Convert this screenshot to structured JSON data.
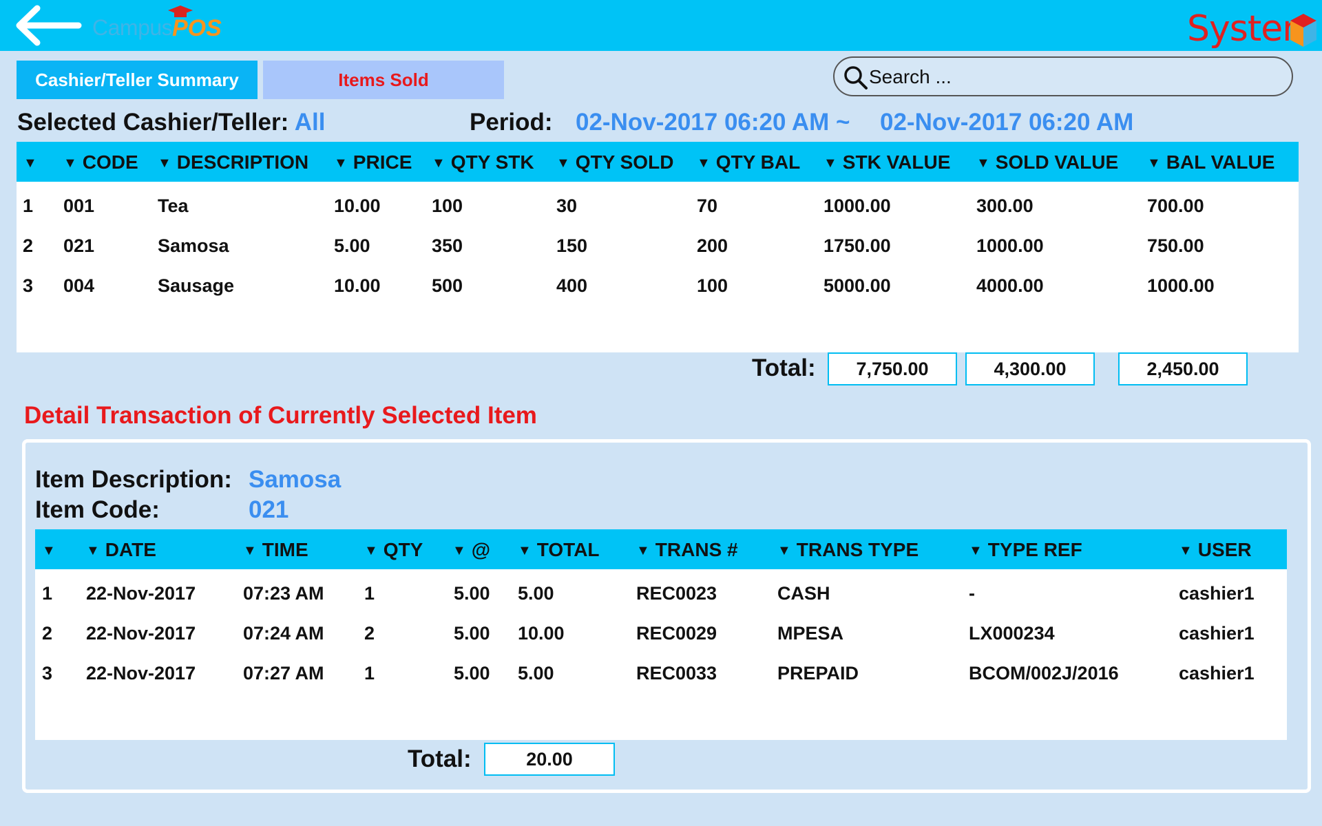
{
  "header": {
    "logo_campus": "Campus",
    "logo_pos": "POS",
    "logo_right": "System"
  },
  "tabs": [
    {
      "label": "Cashier/Teller Summary"
    },
    {
      "label": "Items Sold"
    }
  ],
  "search": {
    "placeholder": "Search ..."
  },
  "summary": {
    "cashier_label": "Selected Cashier/Teller:",
    "cashier_value": "All",
    "period_label": "Period:",
    "period_from": "02-Nov-2017 06:20 AM ~",
    "period_to": "02-Nov-2017 06:20 AM"
  },
  "items_table": {
    "columns": [
      "",
      "CODE",
      "DESCRIPTION",
      "PRICE",
      "QTY STK",
      "QTY SOLD",
      "QTY BAL",
      "STK VALUE",
      "SOLD VALUE",
      "BAL VALUE"
    ],
    "rows": [
      [
        "1",
        "001",
        "Tea",
        "10.00",
        "100",
        "30",
        "70",
        "1000.00",
        "300.00",
        "700.00"
      ],
      [
        "2",
        "021",
        "Samosa",
        "5.00",
        "350",
        "150",
        "200",
        "1750.00",
        "1000.00",
        "750.00"
      ],
      [
        "3",
        "004",
        "Sausage",
        "10.00",
        "500",
        "400",
        "100",
        "5000.00",
        "4000.00",
        "1000.00"
      ]
    ],
    "total_label": "Total:",
    "totals": [
      "7,750.00",
      "4,300.00",
      "2,450.00"
    ]
  },
  "detail": {
    "title": "Detail Transaction of Currently Selected Item",
    "desc_label": "Item Description:",
    "desc_value": "Samosa",
    "code_label": "Item Code:",
    "code_value": "021",
    "columns": [
      "",
      "DATE",
      "TIME",
      "QTY",
      "@",
      "TOTAL",
      "TRANS #",
      "TRANS TYPE",
      "TYPE REF",
      "USER"
    ],
    "rows": [
      [
        "1",
        "22-Nov-2017",
        "07:23 AM",
        "1",
        "5.00",
        "5.00",
        "REC0023",
        "CASH",
        "-",
        "cashier1"
      ],
      [
        "2",
        "22-Nov-2017",
        "07:24 AM",
        "2",
        "5.00",
        "10.00",
        "REC0029",
        "MPESA",
        "LX000234",
        "cashier1"
      ],
      [
        "3",
        "22-Nov-2017",
        "07:27 AM",
        "1",
        "5.00",
        "5.00",
        "REC0033",
        "PREPAID",
        "BCOM/002J/2016",
        "cashier1"
      ]
    ],
    "total_label": "Total:",
    "total": "20.00"
  },
  "colors": {
    "topbar": "#00c3f6",
    "background": "#cfe3f5",
    "accent_blue": "#3a8ef0",
    "accent_red": "#e8191c",
    "tab_active": "#0ab4f5",
    "tab_inactive": "#a9c6fb"
  }
}
